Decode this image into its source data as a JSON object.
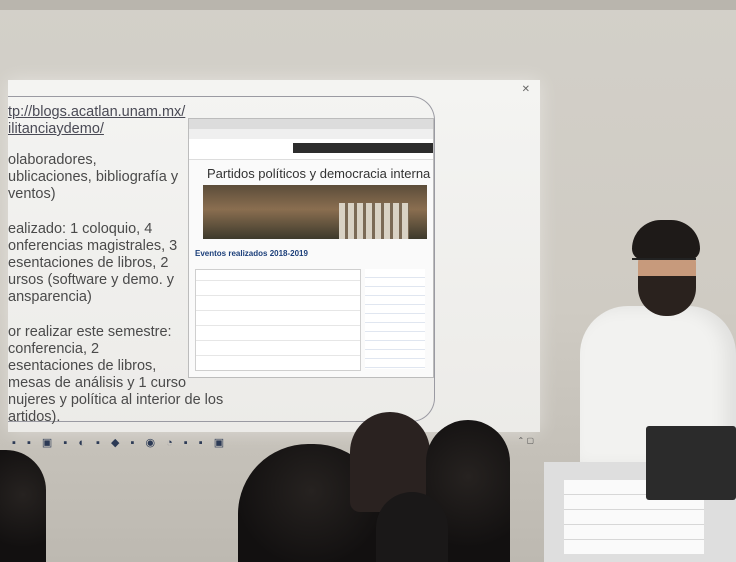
{
  "slide": {
    "url_lines": [
      "tp://blogs.acatlan.unam.mx/",
      "ilitanciaydemo/"
    ],
    "paragraphs": [
      "olaboradores,\nublicaciones, bibliografía y\nventos)",
      "ealizado: 1 coloquio, 4\nonferencias magistrales, 3\nesentaciones de libros, 2\nursos (software y demo. y\nansparencia)",
      "or realizar este semestre:\nconferencia, 2\nesentaciones de libros,\nmesas de análisis y 1 curso\nnujeres y política al interior de los\nartidos)."
    ]
  },
  "browser": {
    "site_title": "Partidos políticos y democracia interna",
    "events_heading": "Eventos realizados 2018-2019"
  }
}
